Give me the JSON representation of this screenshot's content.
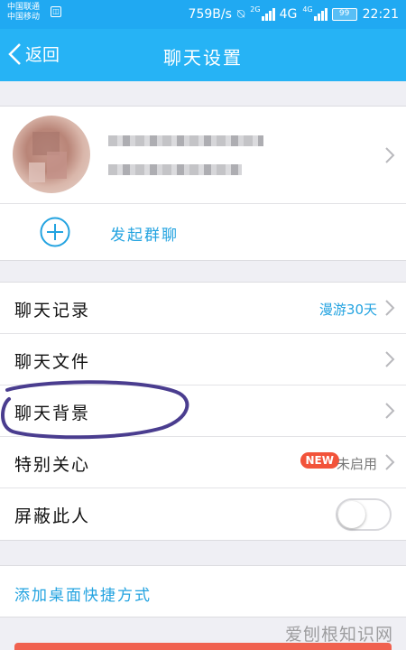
{
  "status_bar": {
    "carrier_1": "中国联通",
    "carrier_2": "中国移动",
    "net_speed": "759B/s",
    "net_type_1": "4G",
    "net_type_2": "4G",
    "battery": "99",
    "time": "22:21"
  },
  "title_bar": {
    "back_label": "返回",
    "title": "聊天设置"
  },
  "contact": {
    "start_group_label": "发起群聊"
  },
  "settings": [
    {
      "label": "聊天记录",
      "value": "漫游30天"
    },
    {
      "label": "聊天文件"
    },
    {
      "label": "聊天背景"
    },
    {
      "label": "特别关心",
      "badge": "NEW",
      "value": "未启用"
    },
    {
      "label": "屏蔽此人",
      "toggle_on": false
    }
  ],
  "shortcut_label": "添加桌面快捷方式",
  "watermark": "爱刨根知识网",
  "colors": {
    "accent": "#26b3f5",
    "link": "#23a3e0",
    "badge": "#f2533a",
    "annotation": "#4a3d8f"
  }
}
